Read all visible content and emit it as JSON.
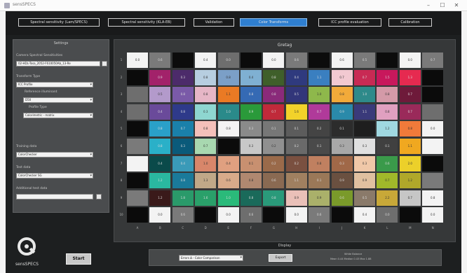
{
  "window": {
    "title": "sensSPECS",
    "controls": [
      "–",
      "☐",
      "✕"
    ]
  },
  "tabs": [
    {
      "label": "Spectral sensitivity (Lam/SPECS)",
      "active": false
    },
    {
      "label": "Spectral sensitivity (KLA-EB)",
      "active": false
    },
    {
      "label": "Validation",
      "active": false
    },
    {
      "label": "Color Transforms",
      "active": true
    },
    {
      "label": "ICC profile evaluation",
      "active": false
    },
    {
      "label": "Calibration",
      "active": false
    }
  ],
  "settings": {
    "title": "Settings",
    "spectral_label": "Camera Spectral Sensitivities",
    "spectral_value": "02-HDL-Tosa_2052-F610050Ab_13-Re",
    "transform_label": "Transform Type",
    "transform_value": "ICC Profile",
    "ref_illuminant_label": "Reference illuminant",
    "ref_illuminant_value": "D50",
    "profile_type_label": "Profile Type",
    "profile_type_value": "Colorimetric - matrix",
    "training_label": "Training data",
    "training_value": "ColorChecker",
    "test_label": "Test data",
    "test_value": "ColorChecker SG",
    "additional_label": "Additional test data",
    "additional_value": "",
    "start_label": "Start"
  },
  "logo_text": "sensSPECS",
  "chart": {
    "title": "Gretag",
    "row_labels": [
      "1",
      "2",
      "3",
      "4",
      "5",
      "6",
      "7",
      "8",
      "9",
      "10"
    ],
    "col_labels": [
      "A",
      "B",
      "C",
      "D",
      "E",
      "F",
      "G",
      "H",
      "I",
      "J",
      "K",
      "L",
      "M",
      "N"
    ],
    "rows": [
      [
        "#f3f3f3",
        "#7a7a7a",
        "#0c0c0c",
        "#f3f3f3",
        "#6e6e6e",
        "#0b0b0b",
        "#f3f3f3",
        "#7a7a7a",
        "#0c0c0c",
        "#f3f3f3",
        "#7a7a7a",
        "#0c0c0c",
        "#f3f3f3",
        "#7a7a7a"
      ],
      [
        "#0b0b0b",
        "#a2226a",
        "#4c2b6a",
        "#b7cee0",
        "#7b9fc7",
        "#7fb0d2",
        "#3f5f2a",
        "#2f3a7e",
        "#3a7fc0",
        "#f2c9d1",
        "#c82a54",
        "#c8185c",
        "#e62a50",
        "#0b0b0b"
      ],
      [
        "#6e6e6e",
        "#b39acb",
        "#7a5aa8",
        "#e6b6c6",
        "#ea7a24",
        "#356ab4",
        "#8a2a7a",
        "#32367a",
        "#8eb84b",
        "#f2aa3a",
        "#2e8a8a",
        "#d49aa8",
        "#6e1a3a",
        "#0b0b0b"
      ],
      [
        "#6e6e6e",
        "#6a4a9a",
        "#2e3a8a",
        "#8ed6d0",
        "#2a8a8a",
        "#2a9a3a",
        "#c02a3a",
        "#f2d22a",
        "#b03a9a",
        "#2a8aaa",
        "#3a3a7a",
        "#e0a0c0",
        "#9a2a5a",
        "#6e6e6e"
      ],
      [
        "#0b0b0b",
        "#2aa0c8",
        "#1a80aa",
        "#f4c0ba",
        "#f3f3f3",
        "#8a8a8a",
        "#777777",
        "#5c5c5c",
        "#444444",
        "#2c2c2c",
        "#1e1e1e",
        "#a0d8e0",
        "#f07a3a",
        "#f3f3f3"
      ],
      [
        "#7a7a7a",
        "#2ab0c8",
        "#0a5a7a",
        "#a8d8b0",
        "#0b0b0b",
        "#c8c8c8",
        "#909090",
        "#6a6a6a",
        "#4a4a4a",
        "#a8a8a8",
        "#e0e0e0",
        "#404040",
        "#f0a820",
        "#f3f3f3"
      ],
      [
        "#f3f3f3",
        "#0a4a4a",
        "#3a9ab8",
        "#d8866a",
        "#e0a080",
        "#c89070",
        "#9a6a4a",
        "#7a5040",
        "#c08060",
        "#a06848",
        "#f0c8a8",
        "#3a9a4a",
        "#ecd02a",
        "#0b0b0b"
      ],
      [
        "#0b0b0b",
        "#2ab8a0",
        "#1a7a9a",
        "#c0a888",
        "#d8aa8a",
        "#b08870",
        "#8a6a52",
        "#a08060",
        "#9a7858",
        "#6a5040",
        "#e0c0a0",
        "#a0b82a",
        "#b0a82a",
        "#7a7a7a"
      ],
      [
        "#7a7a7a",
        "#3a1a1a",
        "#2a9a6a",
        "#2aa06a",
        "#2aba7a",
        "#1a6a5a",
        "#2a9a7a",
        "#eac0b8",
        "#aab06a",
        "#7a9a2a",
        "#8a7a6a",
        "#c8a838",
        "#c6c6c6",
        "#f3f3f3"
      ],
      [
        "#0b0b0b",
        "#f3f3f3",
        "#7a7a7a",
        "#0b0b0b",
        "#f3f3f3",
        "#6e6e6e",
        "#0b0b0b",
        "#f3f3f3",
        "#7a7a7a",
        "#0b0b0b",
        "#f3f3f3",
        "#6e6e6e",
        "#0b0b0b",
        "#f3f3f3"
      ]
    ],
    "values": [
      [
        "0.0",
        "0.6",
        "",
        "0.4",
        "0.0",
        "",
        "0.0",
        "0.6",
        "",
        "0.6",
        "0.5",
        "",
        "0.0",
        "0.7"
      ],
      [
        "",
        "0.9",
        "0.3",
        "0.8",
        "0.8",
        "0.4",
        "0.8",
        "0.4",
        "1.1",
        "0.7",
        "0.7",
        "1.5",
        "1.3",
        ""
      ],
      [
        "",
        "0.5",
        "0.8",
        "0.8",
        "1.1",
        "0.8",
        "0.8",
        "0.5",
        "1.0",
        "0.8",
        "1.0",
        "0.8",
        "0.7",
        ""
      ],
      [
        "",
        "0.4",
        "0.8",
        "0.3",
        "1.0",
        "0.9",
        "0.7",
        "1.6",
        "0.7",
        "0.9",
        "1.1",
        "0.8",
        "0.7",
        ""
      ],
      [
        "",
        "0.8",
        "0.7",
        "0.8",
        "0.8",
        "0.3",
        "0.1",
        "0.1",
        "0.2",
        "0.1",
        "",
        "1.2",
        "0.8",
        "0.0"
      ],
      [
        "",
        "0.8",
        "0.3",
        "0.7",
        "",
        "0.3",
        "0.2",
        "0.2",
        "0.1",
        "0.3",
        "0.3",
        "0.1",
        "1.1",
        ""
      ],
      [
        "",
        "0.4",
        "0.4",
        "1.0",
        "0.4",
        "0.1",
        "0.2",
        "0.2",
        "0.8",
        "0.3",
        "0.3",
        "0.6",
        "2.0",
        ""
      ],
      [
        "",
        "1.2",
        "0.8",
        "1.3",
        "0.6",
        "0.8",
        "0.6",
        "1.1",
        "0.1",
        "0.9",
        "0.9",
        "0.7",
        "1.2",
        ""
      ],
      [
        "",
        "1.2",
        "1.8",
        "1.6",
        "1.0",
        "0.8",
        "0.8",
        "0.9",
        "0.9",
        "0.6",
        "0.5",
        "2.2",
        "0.7",
        "0.8"
      ],
      [
        "",
        "0.0",
        "0.6",
        "",
        "0.0",
        "0.6",
        "",
        "0.0",
        "0.6",
        "",
        "0.4",
        "0.0",
        "",
        "0.0"
      ]
    ]
  },
  "display_label": "Display",
  "bottom": {
    "select_value": "Errors Δ - Color Comparison",
    "export_label": "Export",
    "wb_title": "White Balance",
    "wb_values": "Mean  0.44    Median  0.43    Max  1.88"
  }
}
